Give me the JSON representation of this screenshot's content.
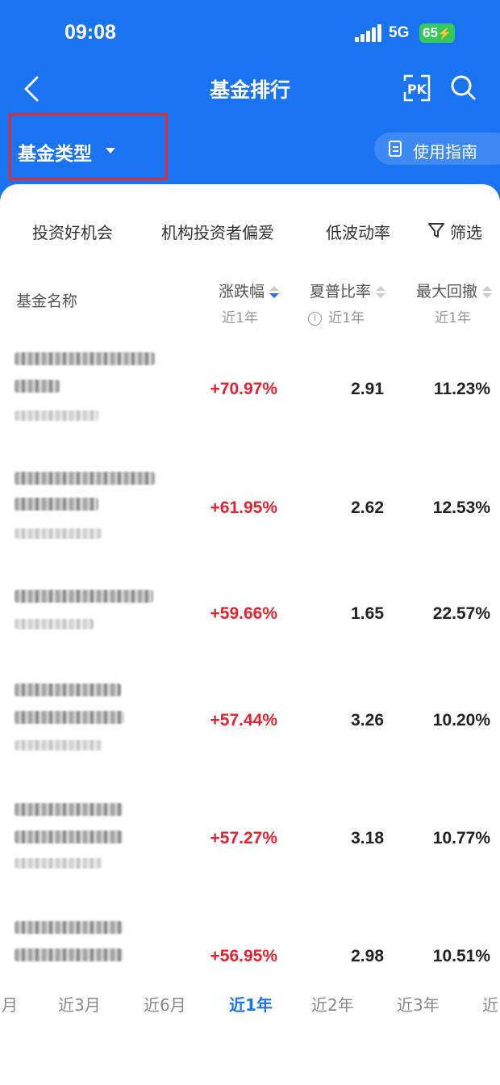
{
  "status": {
    "time": "09:08",
    "network": "5G",
    "battery": "65"
  },
  "nav": {
    "title": "基金排行"
  },
  "type_filter": {
    "label": "基金类型"
  },
  "guide": {
    "label": "使用指南"
  },
  "filters": {
    "items": [
      "投资好机会",
      "机构投资者偏爱",
      "低波动率"
    ],
    "filter_label": "筛选"
  },
  "table": {
    "name_header": "基金名称",
    "columns": [
      {
        "label": "涨跌幅",
        "sub": "近1年"
      },
      {
        "label": "夏普比率",
        "sub": "近1年"
      },
      {
        "label": "最大回撤",
        "sub": "近1年"
      }
    ],
    "rows": [
      {
        "change": "+70.97%",
        "sharpe": "2.91",
        "drawdown": "11.23%"
      },
      {
        "change": "+61.95%",
        "sharpe": "2.62",
        "drawdown": "12.53%"
      },
      {
        "change": "+59.66%",
        "sharpe": "1.65",
        "drawdown": "22.57%"
      },
      {
        "change": "+57.44%",
        "sharpe": "3.26",
        "drawdown": "10.20%"
      },
      {
        "change": "+57.27%",
        "sharpe": "3.18",
        "drawdown": "10.77%"
      },
      {
        "change": "+56.95%",
        "sharpe": "2.98",
        "drawdown": "10.51%"
      }
    ]
  },
  "period_tabs": {
    "items": [
      "月",
      "近3月",
      "近6月",
      "近1年",
      "近2年",
      "近3年",
      "近"
    ],
    "active": "近1年"
  },
  "colors": {
    "brand": "#1a73f0",
    "up": "#e5222e",
    "highlight_box": "#e52b2b"
  }
}
